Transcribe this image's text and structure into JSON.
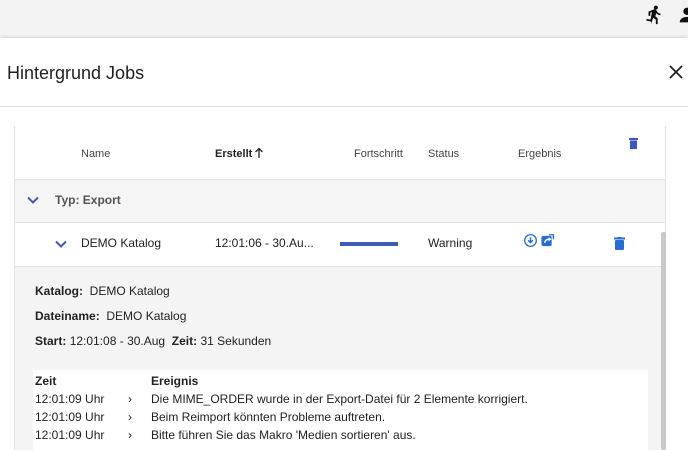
{
  "dialog": {
    "title": "Hintergrund Jobs"
  },
  "table": {
    "headers": {
      "name": "Name",
      "created": "Erstellt",
      "progress": "Fortschritt",
      "status": "Status",
      "result": "Ergebnis"
    },
    "group": {
      "label": "Typ: Export"
    },
    "job": {
      "name": "DEMO Katalog",
      "created": "12:01:06 - 30.Au...",
      "progress": 1.0,
      "status": "Warning"
    }
  },
  "details": {
    "katalog_label": "Katalog:",
    "katalog_value": "DEMO Katalog",
    "dateiname_label": "Dateiname:",
    "dateiname_value": "DEMO Katalog",
    "start_label": "Start:",
    "start_value": "12:01:08 - 30.Aug",
    "zeit_label": "Zeit:",
    "zeit_value": "31 Sekunden",
    "events_header": {
      "time": "Zeit",
      "event": "Ereignis"
    },
    "events": [
      {
        "time": "12:01:09 Uhr",
        "arrow": "›",
        "text": "Die MIME_ORDER wurde in der Export-Datei für 2 Elemente korrigiert."
      },
      {
        "time": "12:01:09 Uhr",
        "arrow": "›",
        "text": "Beim Reimport könnten Probleme auftreten."
      },
      {
        "time": "12:01:09 Uhr",
        "arrow": "›",
        "text": "Bitte führen Sie das Makro 'Medien sortieren' aus."
      }
    ]
  },
  "colors": {
    "accent": "#3f5bb5",
    "icon_blue": "#2b6cd1"
  }
}
